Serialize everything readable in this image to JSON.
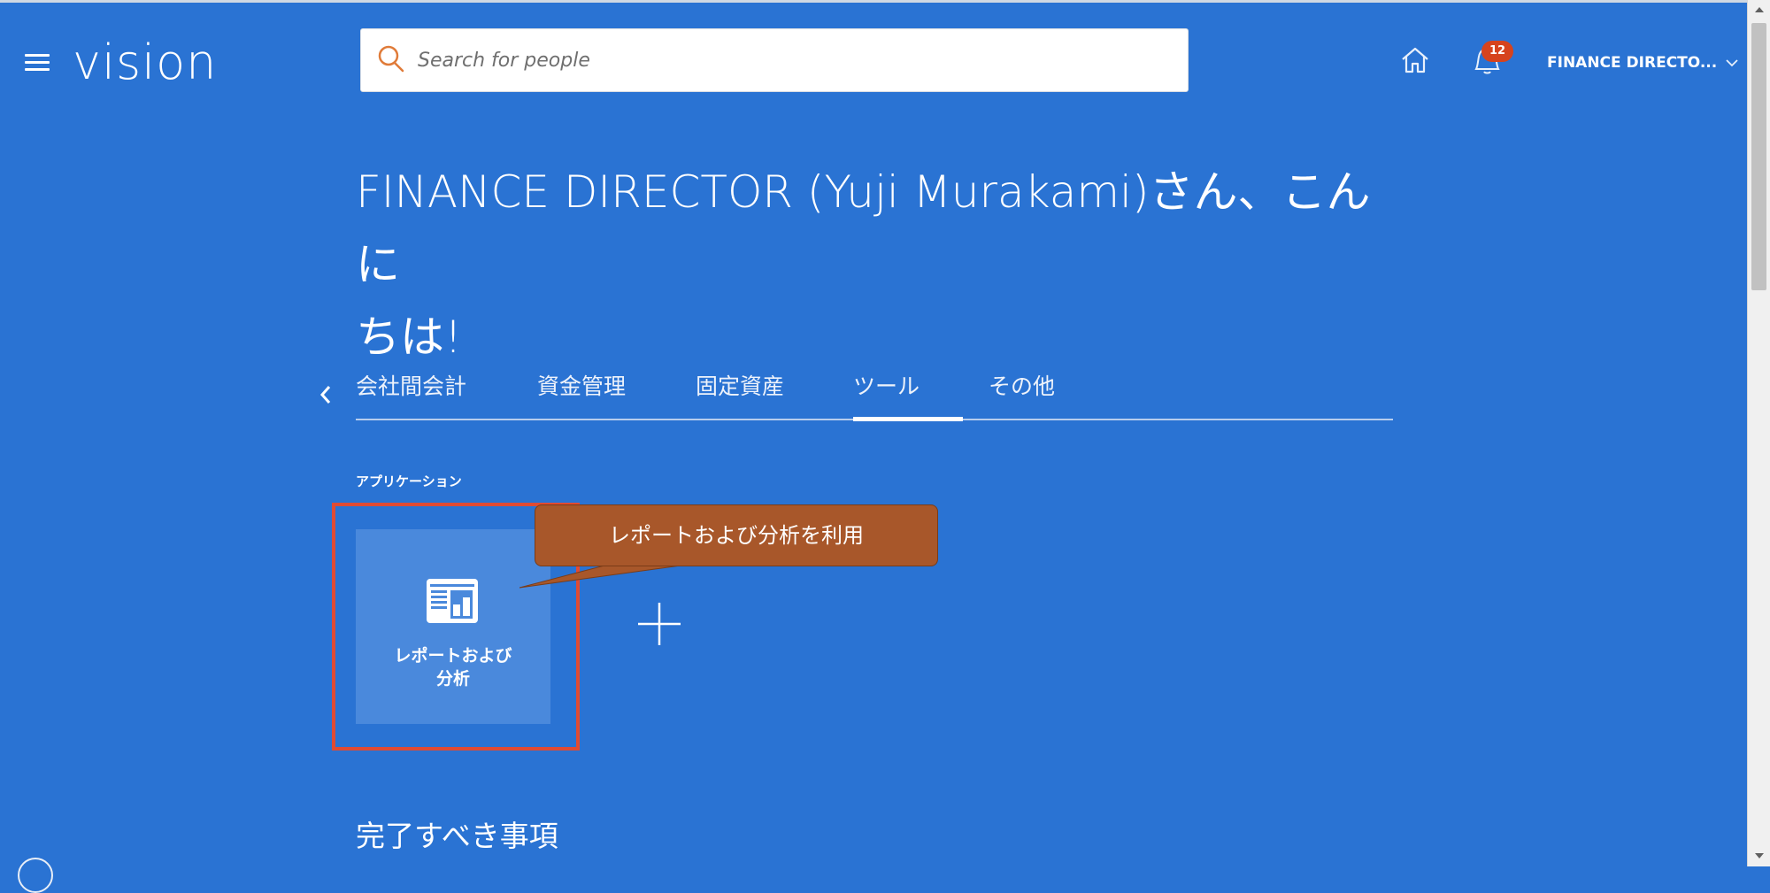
{
  "header": {
    "logo_text": "vision",
    "search_placeholder": "Search for people",
    "notification_count": "12",
    "user_name": "FINANCE DIRECTO..."
  },
  "greeting": {
    "line1": "FINANCE DIRECTOR (Yuji Murakami)さん、こんに",
    "line2": "ちは!"
  },
  "tabs": [
    {
      "label": "会社間会計",
      "active": false
    },
    {
      "label": "資金管理",
      "active": false
    },
    {
      "label": "固定資産",
      "active": false
    },
    {
      "label": "ツール",
      "active": true
    },
    {
      "label": "その他",
      "active": false
    }
  ],
  "apps": {
    "section_label": "アプリケーション",
    "tile_label_line1": "レポートおよび",
    "tile_label_line2": "分析"
  },
  "callout": {
    "text": "レポートおよび分析を利用"
  },
  "todo": {
    "title": "完了すべき事項"
  },
  "colors": {
    "background": "#2a73d3",
    "tile": "#4a89dc",
    "highlight": "#e04b33",
    "callout": "#a8572a",
    "badge": "#d6431d"
  }
}
